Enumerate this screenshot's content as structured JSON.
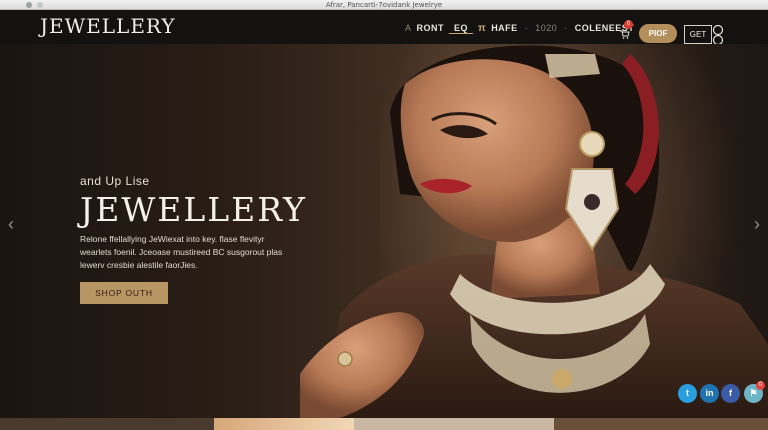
{
  "browser": {
    "url": "Afrar, Pancarti-7ovidank Jewelrye"
  },
  "nav": {
    "logo": "JEWELLERY",
    "items": [
      {
        "label": "A",
        "style": "dim"
      },
      {
        "label": "RONT",
        "style": "normal"
      },
      {
        "label": "EQ",
        "style": "active"
      },
      {
        "label": "π",
        "style": "glyph"
      },
      {
        "label": "HAFE",
        "style": "normal"
      },
      {
        "label": "·",
        "style": "sep"
      },
      {
        "label": "1020",
        "style": "dim"
      },
      {
        "label": "·",
        "style": "sep"
      },
      {
        "label": "COLENEEST",
        "style": "normal"
      },
      {
        "label": "·",
        "style": "sep"
      }
    ],
    "cart_icon": "cart-icon",
    "cart_badge": "0",
    "prof_button": "PIOF",
    "get_button": "GET",
    "user_icon": "user-icon"
  },
  "hero": {
    "eyebrow": "and Up Lise",
    "title": "JEWELLERY",
    "description_lines": [
      "Relone ffellallying JeWiexat into key. flase flevityr",
      "wearlets foenil. Jceoase mustireed BC susgorout plas",
      "lewerv cresbie alestile faorJies."
    ],
    "shop_button": "SHOP OUTH",
    "prev_arrow": "‹",
    "next_arrow": "›"
  },
  "social": {
    "items": [
      {
        "name": "twitter-icon",
        "glyph": "t"
      },
      {
        "name": "linkedin-icon",
        "glyph": "in"
      },
      {
        "name": "facebook-icon",
        "glyph": "f"
      },
      {
        "name": "share-icon",
        "glyph": "⚑"
      }
    ],
    "badge": "0"
  },
  "colors": {
    "accent_gold": "#b89664",
    "nav_bg": "#141210",
    "badge_red": "#d83a2e"
  }
}
